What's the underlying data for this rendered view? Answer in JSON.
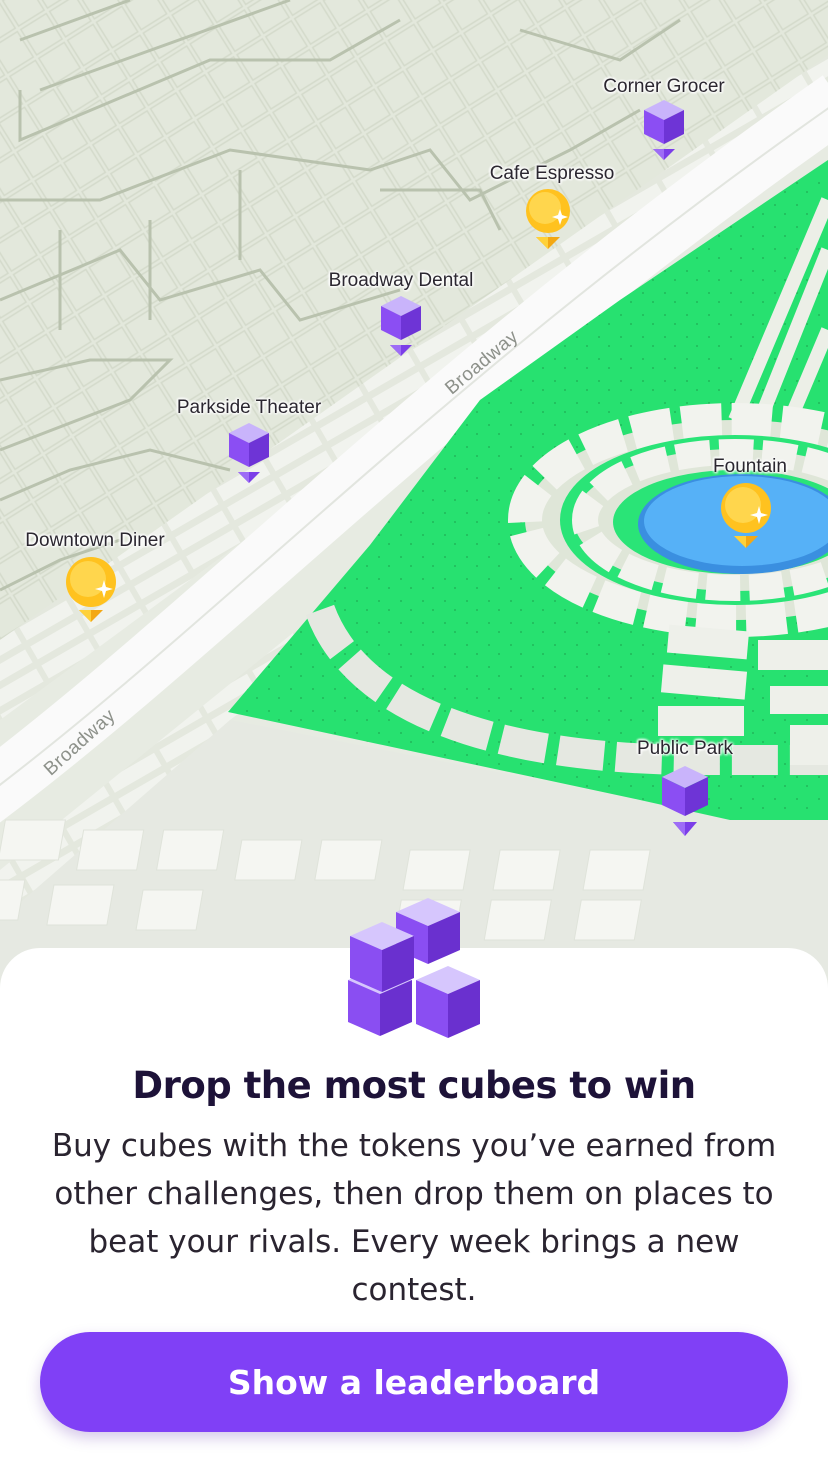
{
  "map": {
    "streets": [
      {
        "name": "Broadway"
      },
      {
        "name": "Broadway"
      }
    ],
    "places": [
      {
        "name": "Corner Grocer",
        "icon": "cube-pin-icon"
      },
      {
        "name": "Cafe Espresso",
        "icon": "coin-pin-icon"
      },
      {
        "name": "Broadway Dental",
        "icon": "cube-pin-icon"
      },
      {
        "name": "Parkside Theater",
        "icon": "cube-pin-icon"
      },
      {
        "name": "Downtown Diner",
        "icon": "coin-pin-icon"
      },
      {
        "name": "Fountain",
        "icon": "coin-pin-icon"
      },
      {
        "name": "Public Park",
        "icon": "cube-pin-icon"
      }
    ]
  },
  "sheet": {
    "hero_icon": "stacked-cubes-icon",
    "title": "Drop the most cubes to win",
    "body": "Buy cubes with the tokens you’ve earned from other challenges, then drop them on places to beat your rivals. Every week brings a new contest.",
    "cta_label": "Show a leaderboard"
  },
  "colors": {
    "accent": "#8040f6",
    "park": "#2ae477",
    "water": "#4ba9f5",
    "coin": "#ffc21f",
    "cube": "#8a4ef2"
  }
}
